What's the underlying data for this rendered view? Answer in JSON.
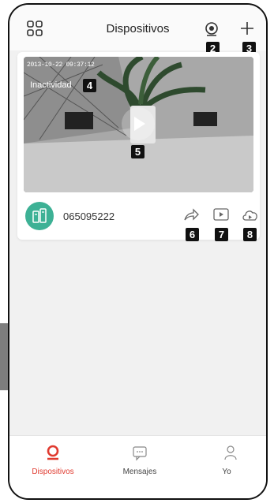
{
  "header": {
    "title": "Dispositivos",
    "left_icon": "grid-icon",
    "right_icons": [
      "camera-icon",
      "plus-icon"
    ]
  },
  "badges": [
    "2",
    "3",
    "4",
    "5",
    "6",
    "7",
    "8"
  ],
  "device": {
    "timestamp": "2013-10-22 09:37:12",
    "status": "Inactividad",
    "name": "065095222",
    "icons": [
      "share-icon",
      "playback-icon",
      "cloud-icon"
    ]
  },
  "nav": {
    "items": [
      {
        "label": "Dispositivos",
        "icon": "home-icon",
        "active": true
      },
      {
        "label": "Mensajes",
        "icon": "message-icon",
        "active": false
      },
      {
        "label": "Yo",
        "icon": "user-icon",
        "active": false
      }
    ]
  },
  "colors": {
    "accent": "#e03a2f",
    "avatar": "#3db195",
    "badge": "#111111"
  }
}
